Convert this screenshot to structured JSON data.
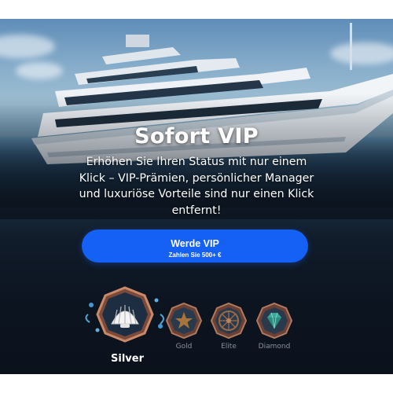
{
  "hero": {
    "title": "Sofort VIP",
    "description": "Erhöhen Sie Ihren Status mit nur einem Klick – VIP-Prämien, persönlicher Manager und luxuriöse Vorteile sind nur einen Klick entfernt!"
  },
  "cta": {
    "label": "Werde VIP",
    "sublabel": "Zahlen Sie 500+ €",
    "color": "#1560f5"
  },
  "tiers": [
    {
      "name": "Silver",
      "icon": "shell-icon",
      "active": true
    },
    {
      "name": "Gold",
      "icon": "star-icon",
      "active": false
    },
    {
      "name": "Elite",
      "icon": "compass-icon",
      "active": false
    },
    {
      "name": "Diamond",
      "icon": "diamond-icon",
      "active": false
    }
  ]
}
